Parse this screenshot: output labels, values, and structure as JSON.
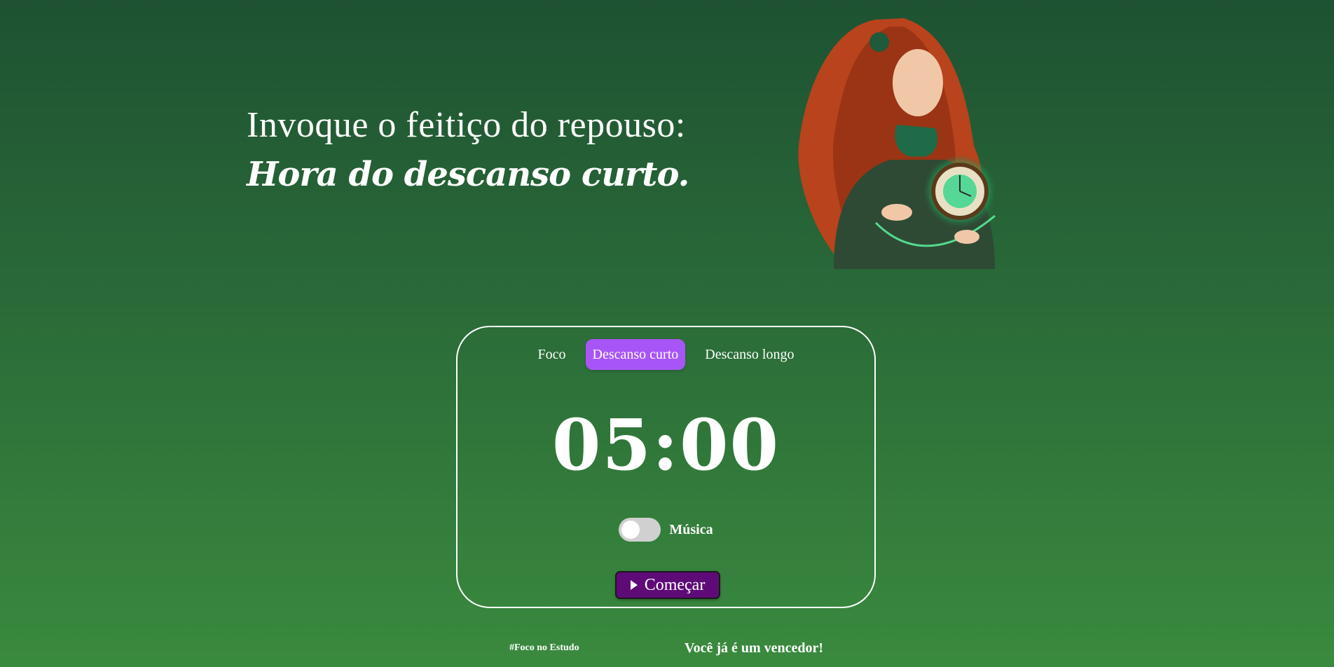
{
  "hero": {
    "line1": "Invoque o feitiço do repouso:",
    "line2": "Hora do descanso curto.",
    "image_alt": "sorceress-with-clock"
  },
  "timer": {
    "tabs": [
      {
        "label": "Foco",
        "active": false
      },
      {
        "label": "Descanso curto",
        "active": true
      },
      {
        "label": "Descanso longo",
        "active": false
      }
    ],
    "time": "05:00",
    "music": {
      "label": "Música",
      "enabled": false
    },
    "start_label": "Começar",
    "start_icon": "play-icon"
  },
  "footer": {
    "tag": "#Foco no Estudo",
    "message": "Você já é um vencedor!"
  },
  "colors": {
    "background_top": "#1e5232",
    "background_bottom": "#3a8a3e",
    "active_tab": "#a855f7",
    "start_button": "#5e0b78",
    "toggle_off": "#d0d0d0"
  }
}
